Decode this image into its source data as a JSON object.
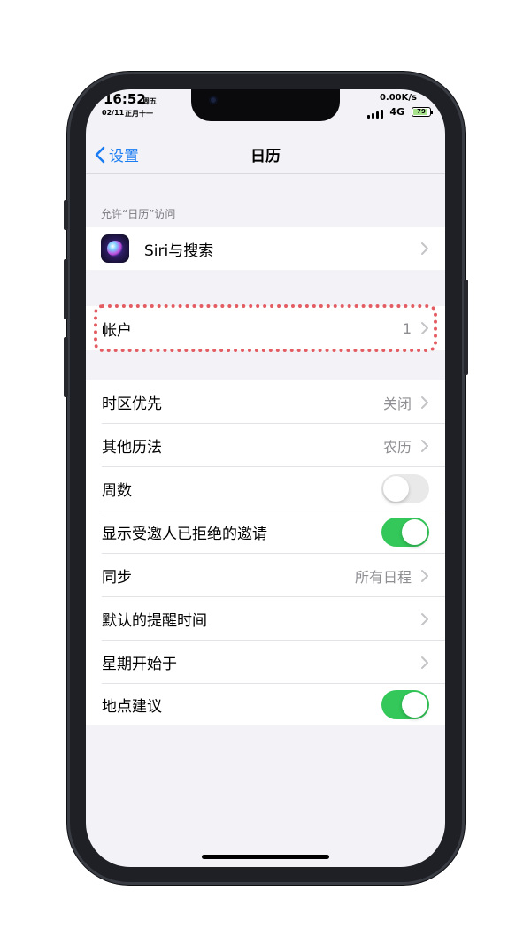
{
  "status_bar": {
    "time": "16:52",
    "weekday": "周五",
    "date": "02/11",
    "lunar_date": "正月十一",
    "net_speed": "0.00K/s",
    "network": "4G",
    "battery": "79"
  },
  "nav": {
    "back_label": "设置",
    "title": "日历"
  },
  "section_header": "允许“日历”访问",
  "siri_row": {
    "label": "Siri与搜索",
    "icon": "siri-icon"
  },
  "accounts_row": {
    "label": "帐户",
    "value": "1"
  },
  "settings": [
    {
      "label": "时区优先",
      "value": "关闭"
    },
    {
      "label": "其他历法",
      "value": "农历"
    },
    {
      "label": "周数",
      "toggle": false
    },
    {
      "label": "显示受邀人已拒绝的邀请",
      "toggle": true
    },
    {
      "label": "同步",
      "value": "所有日程"
    },
    {
      "label": "默认的提醒时间",
      "value": ""
    },
    {
      "label": "星期开始于",
      "value": ""
    },
    {
      "label": "地点建议",
      "toggle": true
    }
  ],
  "colors": {
    "accent": "#1a7cf2",
    "toggle_on": "#34c759",
    "highlight": "#e35d63"
  }
}
